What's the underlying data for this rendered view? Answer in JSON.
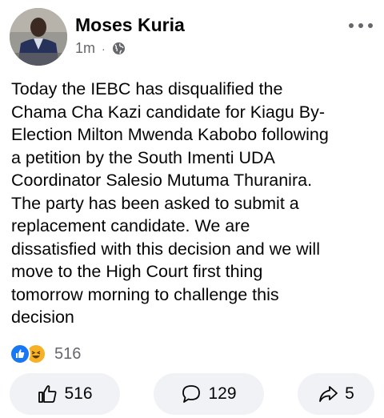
{
  "post": {
    "author": "Moses Kuria",
    "timestamp": "1m",
    "separator": "·",
    "audience_icon": "globe-icon",
    "text_lines": [
      "Today the IEBC has disqualified the",
      "Chama Cha Kazi candidate for Kiagu By-",
      "Election Milton Mwenda Kabobo following",
      "a petition by the South Imenti UDA",
      "Coordinator Salesio Mutuma Thuranira.",
      "The party has been asked to submit a",
      "replacement candidate.  We are",
      "dissatisfied with this decision and we will",
      "move to the High Court first thing",
      "tomorrow morning to challenge this",
      "decision"
    ]
  },
  "reactions": {
    "icons": [
      "like-icon",
      "haha-icon"
    ],
    "count": "516"
  },
  "actions": {
    "like_count": "516",
    "comment_count": "129",
    "share_count": "5"
  },
  "colors": {
    "like_blue": "#1877f2",
    "haha_yellow": "#f7b125",
    "secondary_text": "#65676b",
    "button_bg": "#f0f2f5"
  }
}
